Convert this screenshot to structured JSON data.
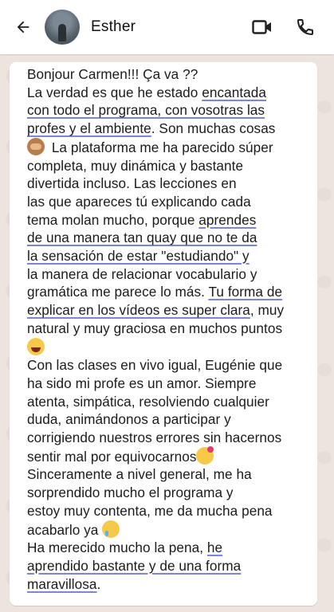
{
  "header": {
    "contact_name": "Esther",
    "back_icon": "arrow-left-icon",
    "video_icon": "video-call-icon",
    "call_icon": "phone-icon"
  },
  "message": {
    "lines_p1": [
      "Bonjour Carmen!!! Ça va ??",
      "La verdad es que he estado ",
      "encantada",
      "con todo el programa, con vosotras las",
      "profes y el ambiente",
      ". Son muchas cosas",
      " La plataforma me ha parecido súper",
      "completa, muy dinámica y bastante",
      "divertida incluso. Las lecciones en",
      "las que apareces tú explicando cada",
      "tema molan mucho, porque ",
      "aprendes",
      "de una manera tan quay que no te da",
      "la sensación de estar \"estudiando\" y",
      "la manera de relacionar vocabulario y",
      "gramática me parece lo más. ",
      "Tu forma de",
      "explicar en los vídeos es super clara",
      ", muy",
      "natural y muy graciosa en muchos puntos"
    ],
    "lines_p2": [
      "Con las clases en vivo igual, Eugénie que",
      "ha sido mi profe es un amor. Siempre",
      "atenta, simpática, resolviendo cualquier",
      "duda, animándonos a participar y",
      "corrigiendo nuestros errores sin hacernos",
      "sentir mal por equivocarnos"
    ],
    "lines_p3": [
      "Sinceramente a nivel general, me ha",
      "sorprendido mucho el programa y",
      "estoy muy contenta, me da mucha pena",
      "acabarlo ya "
    ],
    "lines_p4": [
      "Ha merecido mucho la pena, ",
      "he",
      "aprendido bastante y de una forma",
      "maravillosa",
      "."
    ],
    "emojis": [
      "see-no-evil-monkey",
      "tears-of-joy",
      "smiling-face-with-hearts",
      "pleading-face-with-tear"
    ],
    "underline_color": "#7b86d8"
  }
}
